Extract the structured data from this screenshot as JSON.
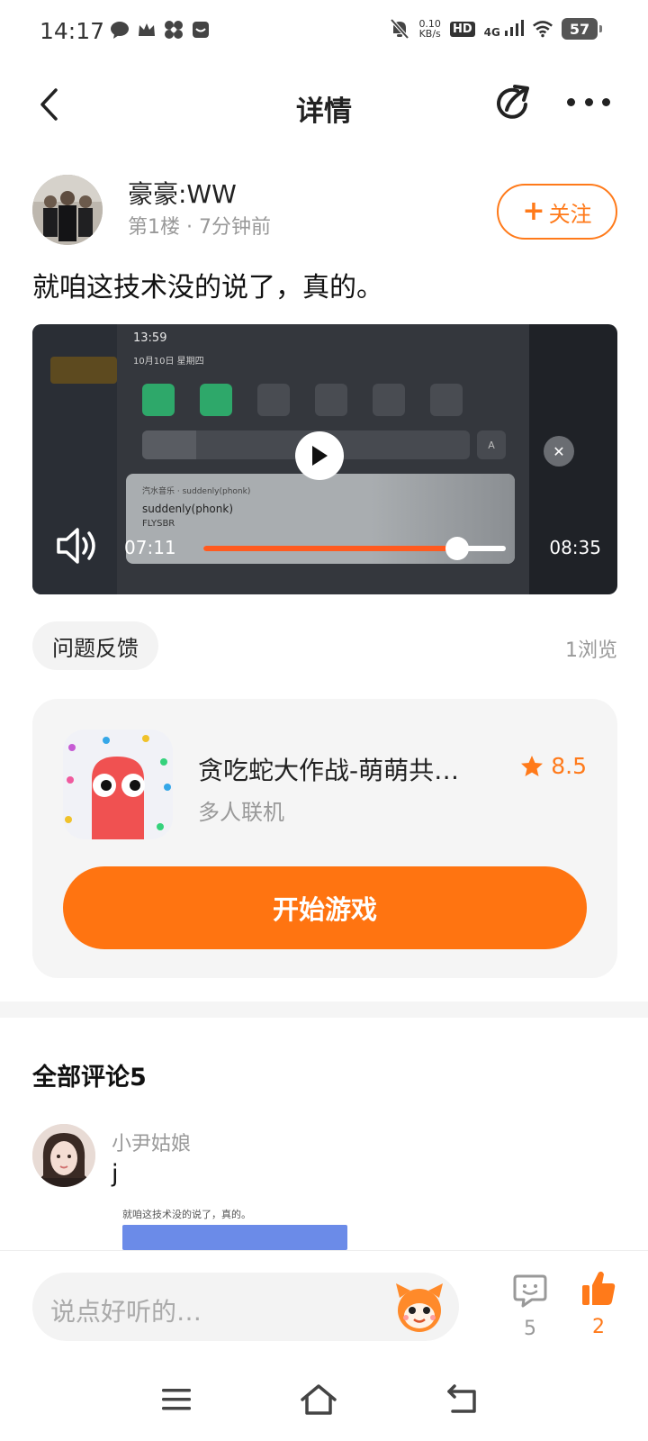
{
  "status_bar": {
    "time": "14:17",
    "net_speed_value": "0.10",
    "net_speed_unit": "KB/s",
    "hd_label": "HD",
    "network_label": "4G",
    "battery": "57"
  },
  "header": {
    "title": "详情"
  },
  "post": {
    "author_name": "豪豪:WW",
    "meta": "第1楼 · 7分钟前",
    "follow_label": "关注",
    "follow_plus": "+",
    "text": "就咱这技术没的说了，真的。",
    "tag": "问题反馈",
    "views": "1浏览"
  },
  "video": {
    "current_time": "07:11",
    "duration": "08:35",
    "progress": 0.84,
    "overlay_time": "13:59",
    "overlay_date": "10月10日 星期四",
    "overlay_music_source": "汽水音乐 · suddenly(phonk)",
    "overlay_song": "suddenly(phonk)",
    "overlay_artist": "FLYSBR",
    "overlay_a": "A"
  },
  "game": {
    "title": "贪吃蛇大作战-萌萌共…",
    "category": "多人联机",
    "rating": "8.5",
    "play_label": "开始游戏"
  },
  "comments": {
    "title": "全部评论5",
    "items": [
      {
        "user": "小尹姑娘",
        "text": "j",
        "preview_text": "就咱这技术没的说了，真的。"
      }
    ]
  },
  "bottom_bar": {
    "input_placeholder": "说点好听的…",
    "comment_count": "5",
    "like_count": "2"
  },
  "colors": {
    "accent": "#ff7411",
    "muted": "#999999"
  },
  "icons": {
    "back": "chevron-left-icon",
    "share": "share-icon",
    "more": "more-icon",
    "play": "play-icon",
    "volume": "volume-icon",
    "star": "star-icon",
    "comment": "comment-icon",
    "like": "thumbs-up-icon"
  }
}
